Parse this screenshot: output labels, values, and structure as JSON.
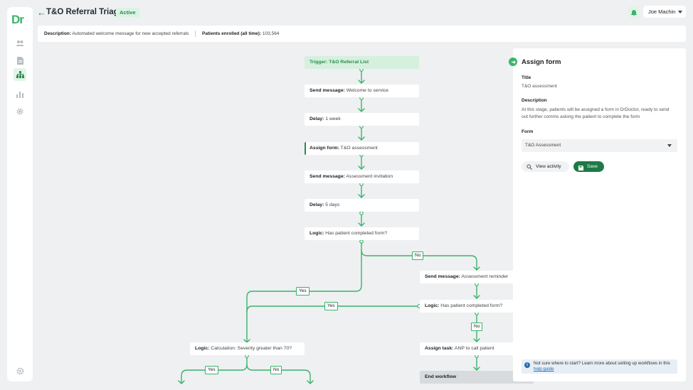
{
  "app": {
    "logo": "Dr"
  },
  "header": {
    "title": "T&O Referral Triage",
    "status": "Active",
    "user": "Joe Machin"
  },
  "description_bar": {
    "description_label": "Description:",
    "description_text": "Automated welcome message for new accepted referrals",
    "patients_label": "Patients enrolled (all time):",
    "patients_value": "103,564"
  },
  "sidebar": {
    "items": [
      {
        "icon": "people-icon"
      },
      {
        "icon": "document-icon"
      },
      {
        "icon": "workflow-icon",
        "active": true
      },
      {
        "icon": "chart-icon"
      },
      {
        "icon": "gear-icon"
      }
    ],
    "bottom_icon": "settings-icon"
  },
  "flow": {
    "nodes": [
      {
        "id": "trigger",
        "bold": "Trigger: T&O Referral List",
        "rest": ""
      },
      {
        "id": "send1",
        "bold": "Send message:",
        "rest": " Welcome to service"
      },
      {
        "id": "delay1",
        "bold": "Delay:",
        "rest": " 1 week"
      },
      {
        "id": "assign",
        "bold": "Assign form:",
        "rest": " T&O assessment"
      },
      {
        "id": "send2",
        "bold": "Send message:",
        "rest": " Assessment invitation"
      },
      {
        "id": "delay2",
        "bold": "Delay:",
        "rest": " 5 days"
      },
      {
        "id": "logic1",
        "bold": "Logic:",
        "rest": " Has patient completed form?"
      },
      {
        "id": "send3",
        "bold": "Send message:",
        "rest": " Assessment reminder"
      },
      {
        "id": "logic2",
        "bold": "Logic:",
        "rest": " Has patient completed form?"
      },
      {
        "id": "logic3",
        "bold": "Logic:",
        "rest": " Calculation: Severity greater than 70?"
      },
      {
        "id": "task",
        "bold": "Assign task:",
        "rest": " ANP to call patient"
      },
      {
        "id": "end",
        "bold": "End workflow",
        "rest": ""
      }
    ],
    "branches": {
      "no1": "No",
      "yes1": "Yes",
      "yes2": "Yes",
      "no2": "No",
      "yes3": "Yes",
      "no3": "No"
    },
    "colors": {
      "line": "#3bb36a",
      "accent": "#2a8c4f"
    }
  },
  "panel": {
    "title": "Assign form",
    "title_label": "Title",
    "title_value": "T&O assessment",
    "description_label": "Description",
    "description_value": "At this stage, patients will be assigned a form in DrDoctor, ready to send out further comms asking the patient to complete the form",
    "form_label": "Form",
    "form_value": "T&O Assessment",
    "view_activity": "View activity",
    "save": "Save",
    "help_text": "Not sure where to start? Learn more about setting up workflows in this",
    "help_link": "help guide"
  }
}
